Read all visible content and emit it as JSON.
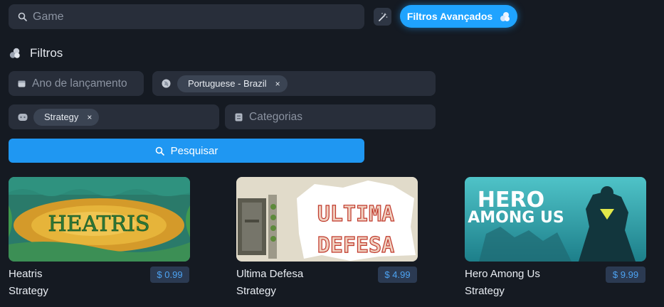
{
  "search": {
    "placeholder": "Game",
    "icon": "search-icon"
  },
  "wand": {
    "icon": "magic-wand-icon"
  },
  "advanced_button": {
    "label": "Filtros Avançados",
    "icon": "filter-balls-icon",
    "color": "#1fa3ff"
  },
  "filters": {
    "title": "Filtros",
    "title_icon": "filter-balls-icon",
    "release_year": {
      "placeholder": "Ano de lançamento",
      "icon": "calendar-icon"
    },
    "language": {
      "icon": "globe-icon",
      "chip": "Portuguese - Brazil",
      "chip_remove": "×"
    },
    "genre": {
      "icon": "gamepad-icon",
      "chip": "Strategy",
      "chip_remove": "×"
    },
    "categories": {
      "placeholder": "Categorias",
      "icon": "category-icon"
    },
    "search_button": {
      "label": "Pesquisar",
      "icon": "search-icon",
      "color": "#1f97f2"
    }
  },
  "games": [
    {
      "title": "Heatris",
      "genre": "Strategy",
      "price": "$ 0.99",
      "cover_text": "HEATRIS"
    },
    {
      "title": "Ultima Defesa",
      "genre": "Strategy",
      "price": "$ 4.99",
      "cover_text": [
        "ULTIMA",
        "DEFESA"
      ]
    },
    {
      "title": "Hero Among Us",
      "genre": "Strategy",
      "price": "$ 9.99",
      "cover_text": [
        "HERO",
        "AMONG US"
      ]
    }
  ],
  "colors": {
    "background": "#151a22",
    "field": "#282e3a",
    "accent": "#1fa3ff",
    "price_text": "#4da3f2",
    "price_bg": "#2b3a52"
  }
}
